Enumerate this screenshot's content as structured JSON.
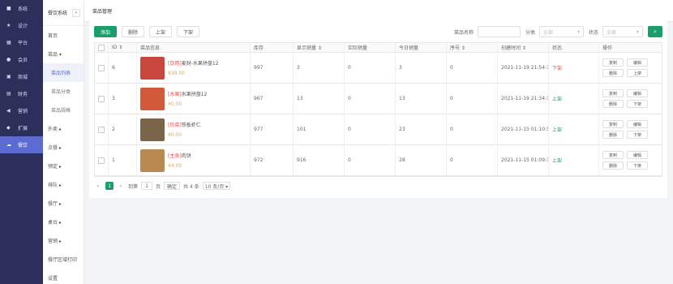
{
  "sidebar": {
    "items": [
      {
        "icon": "■",
        "label": "系统"
      },
      {
        "icon": "★",
        "label": "设计"
      },
      {
        "icon": "▦",
        "label": "平台"
      },
      {
        "icon": "●",
        "label": "会员"
      },
      {
        "icon": "▣",
        "label": "商城"
      },
      {
        "icon": "▤",
        "label": "财务"
      },
      {
        "icon": "◀",
        "label": "营销"
      },
      {
        "icon": "◆",
        "label": "扩展"
      },
      {
        "icon": "☁",
        "label": "餐饮",
        "active": true
      }
    ]
  },
  "subnav": {
    "title": "餐饮系统",
    "collapse": "«",
    "items": [
      {
        "label": "首页"
      },
      {
        "label": "菜品 ▾"
      },
      {
        "label": "菜品列表",
        "child": true,
        "active": true
      },
      {
        "label": "菜品分类",
        "child": true
      },
      {
        "label": "菜品规格",
        "child": true
      },
      {
        "label": "外卖 ▸"
      },
      {
        "label": "点餐 ▸"
      },
      {
        "label": "预定 ▸"
      },
      {
        "label": "排队 ▸"
      },
      {
        "label": "餐厅 ▸"
      },
      {
        "label": "桌台 ▸"
      },
      {
        "label": "营销 ▸"
      },
      {
        "label": "餐厅区域打印"
      },
      {
        "label": "设置"
      }
    ]
  },
  "topbar": {
    "tab": "菜品管理"
  },
  "toolbar": {
    "add": "添加",
    "delete": "删除",
    "on": "上架",
    "off": "下架",
    "name_label": "菜品名称",
    "category_label": "分类",
    "category_value": "全部",
    "status_label": "状态",
    "status_value": "全部",
    "search_icon": "search-icon"
  },
  "table": {
    "headers": {
      "id": "ID ⇕",
      "info": "菜品信息",
      "stock": "库存",
      "display_sales": "显示销量 ⇕",
      "actual_sales": "实际销量",
      "today_sales": "今日销量",
      "sort": "序号 ⇕",
      "time": "创建时间 ⇕",
      "status": "状态",
      "ops": "操作"
    },
    "rows": [
      {
        "id": "6",
        "tag": "[饮用]",
        "name": "麦财-水果拼盘12",
        "price": "¥39.00",
        "stock": "997",
        "display_sales": "3",
        "actual_sales": "0",
        "today_sales": "3",
        "sort": "0",
        "time": "2021-11-19 21:54:19",
        "status": "下架",
        "status_on": false,
        "ops": [
          "复制",
          "编辑",
          "删除",
          "上架"
        ],
        "img": "#c9463d"
      },
      {
        "id": "3",
        "tag": "[水果]",
        "name": "水果拼盘12",
        "price": "¥0.00",
        "stock": "967",
        "display_sales": "13",
        "actual_sales": "0",
        "today_sales": "13",
        "sort": "0",
        "time": "2021-11-19 21:34:19",
        "status": "上架",
        "status_on": true,
        "ops": [
          "复制",
          "编辑",
          "删除",
          "下架"
        ],
        "img": "#d25a3a"
      },
      {
        "id": "2",
        "tag": "[热菜]",
        "name": "铁板虾仁",
        "price": "¥0.00",
        "stock": "977",
        "display_sales": "101",
        "actual_sales": "0",
        "today_sales": "23",
        "sort": "0",
        "time": "2021-11-15 01:10:55",
        "status": "上架",
        "status_on": true,
        "ops": [
          "复制",
          "编辑",
          "删除",
          "下架"
        ],
        "img": "#7a6548"
      },
      {
        "id": "1",
        "tag": "[主食]",
        "name": "肉饼",
        "price": "¥4.00",
        "stock": "972",
        "display_sales": "916",
        "actual_sales": "0",
        "today_sales": "28",
        "sort": "0",
        "time": "2021-11-15 01:09:31",
        "status": "上架",
        "status_on": true,
        "ops": [
          "复制",
          "编辑",
          "删除",
          "下架"
        ],
        "img": "#b88a52"
      }
    ]
  },
  "pager": {
    "prev": "‹",
    "current": "1",
    "next": "›",
    "goto_label": "到第",
    "goto_value": "1",
    "page_unit": "页",
    "confirm": "确定",
    "total": "共 4 条",
    "size": "10 条/页 ▾"
  }
}
